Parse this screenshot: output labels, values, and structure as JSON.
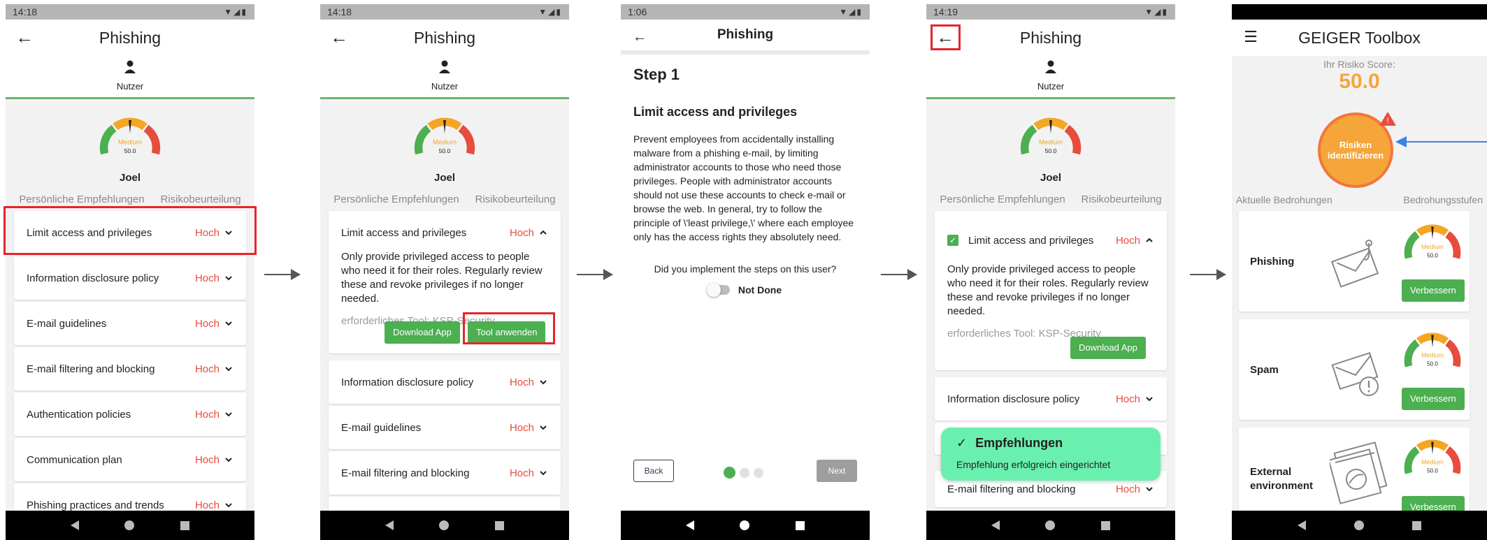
{
  "phone1": {
    "time": "14:18",
    "title": "Phishing",
    "user_label": "Nutzer",
    "gauge_level": "Medium",
    "gauge_value": "50.0",
    "name": "Joel",
    "tab1": "Persönliche Empfehlungen",
    "tab2": "Risikobeurteilung",
    "items": [
      {
        "title": "Limit access and privileges",
        "level": "Hoch"
      },
      {
        "title": "Information disclosure policy",
        "level": "Hoch"
      },
      {
        "title": "E-mail guidelines",
        "level": "Hoch"
      },
      {
        "title": "E-mail filtering and blocking",
        "level": "Hoch"
      },
      {
        "title": "Authentication policies",
        "level": "Hoch"
      },
      {
        "title": "Communication plan",
        "level": "Hoch"
      },
      {
        "title": "Phishing practices and trends",
        "level": "Hoch"
      }
    ]
  },
  "phone2": {
    "time": "14:18",
    "title": "Phishing",
    "user_label": "Nutzer",
    "gauge_level": "Medium",
    "gauge_value": "50.0",
    "name": "Joel",
    "tab1": "Persönliche Empfehlungen",
    "tab2": "Risikobeurteilung",
    "expanded_title": "Limit access and privileges",
    "expanded_level": "Hoch",
    "expanded_text": "Only provide privileged access to people who need it for their roles. Regularly review these and revoke privileges if no longer needed.",
    "tool_note": "erforderliches Tool: KSP-Security",
    "download_btn": "Download App",
    "apply_btn": "Tool anwenden",
    "items": [
      {
        "title": "Information disclosure policy",
        "level": "Hoch"
      },
      {
        "title": "E-mail guidelines",
        "level": "Hoch"
      },
      {
        "title": "E-mail filtering and blocking",
        "level": "Hoch"
      }
    ]
  },
  "phone3": {
    "time": "1:06",
    "title": "Phishing",
    "step": "Step 1",
    "heading": "Limit access and privileges",
    "text": "Prevent employees from accidentally installing malware from a phishing e-mail, by limiting administrator accounts to those who need those privileges. People with administrator accounts should not use these accounts to check e-mail or browse the web. In general, try to follow the principle of \\'least privilege,\\' where each employee only has the access rights they absolutely need.",
    "question": "Did you implement the steps on this user?",
    "toggle_label": "Not Done",
    "back_btn": "Back",
    "next_btn": "Next"
  },
  "phone4": {
    "time": "14:19",
    "title": "Phishing",
    "user_label": "Nutzer",
    "gauge_level": "Medium",
    "gauge_value": "50.0",
    "name": "Joel",
    "tab1": "Persönliche Empfehlungen",
    "tab2": "Risikobeurteilung",
    "expanded_title": "Limit access and privileges",
    "expanded_level": "Hoch",
    "expanded_text": "Only provide privileged access to people who need it for their roles. Regularly review these and revoke privileges if no longer needed.",
    "tool_note": "erforderliches Tool: KSP-Security",
    "download_btn": "Download App",
    "items": [
      {
        "title": "Information disclosure policy",
        "level": "Hoch"
      },
      {
        "title": "E-mail filtering and blocking",
        "level": "Hoch"
      }
    ],
    "toast_title": "Empfehlungen",
    "toast_text": "Empfehlung erfolgreich eingerichtet"
  },
  "phone5": {
    "title": "GEIGER Toolbox",
    "score_label": "Ihr Risiko Score:",
    "score": "50.0",
    "circle_btn": "Risiken identifizieren",
    "left_header": "Aktuelle Bedrohungen",
    "right_header": "Bedrohungsstufen",
    "threats": [
      {
        "name": "Phishing",
        "gauge_level": "Medium",
        "gauge_value": "50.0",
        "btn": "Verbessern"
      },
      {
        "name": "Spam",
        "gauge_level": "Medium",
        "gauge_value": "50.0",
        "btn": "Verbessern"
      },
      {
        "name": "External environment",
        "gauge_level": "Medium",
        "gauge_value": "50.0",
        "btn": "Verbessern"
      }
    ]
  },
  "colors": {
    "accent_green": "#4caf50",
    "level_red": "#e74c3c",
    "score_orange": "#f5a53a",
    "highlight_red": "#e5252a",
    "toast_green": "#69f0ae",
    "pointer_blue": "#3b82e6"
  }
}
